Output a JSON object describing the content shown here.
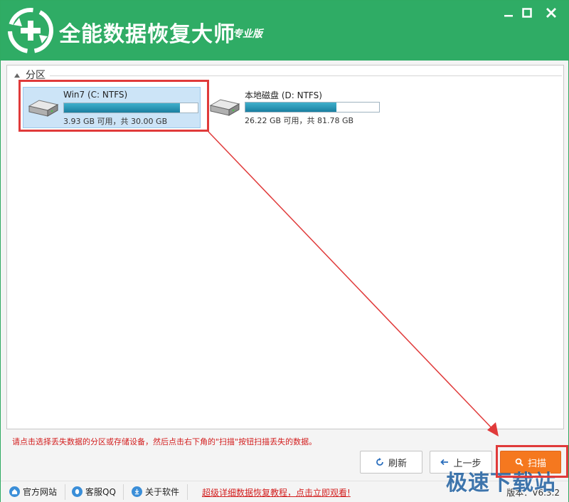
{
  "app": {
    "title": "全能数据恢复大师",
    "edition": "专业版"
  },
  "window": {
    "minimize_icon": "minimize-icon",
    "maximize_icon": "maximize-icon",
    "close_icon": "close-icon"
  },
  "partitions": {
    "label": "分区",
    "drives": [
      {
        "name": "Win7 (C: NTFS)",
        "info": "3.93 GB 可用，共 30.00 GB",
        "used_fraction": 0.869,
        "selected": true
      },
      {
        "name": "本地磁盘 (D: NTFS)",
        "info": "26.22 GB 可用，共 81.78 GB",
        "used_fraction": 0.679,
        "selected": false
      }
    ]
  },
  "hint": "请点击选择丢失数据的分区或存储设备，然后点击右下角的\"扫描\"按钮扫描丢失的数据。",
  "buttons": {
    "refresh": "刷新",
    "back": "上一步",
    "scan": "扫描"
  },
  "footer": {
    "official_site": "官方网站",
    "support_qq": "客服QQ",
    "about": "关于软件",
    "promo": "超级详细数据恢复教程，点击立即观看!",
    "version": "版本：V6.3.2"
  },
  "watermark": "极速下载站",
  "colors": {
    "brand": "#2fac65",
    "scan": "#f5781f",
    "annotation": "#e03a3a"
  }
}
